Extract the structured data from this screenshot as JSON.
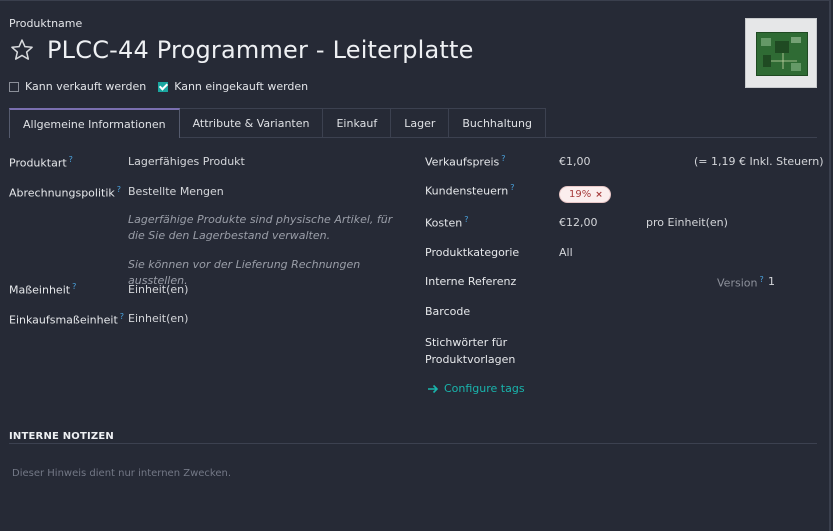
{
  "header": {
    "product_name_label": "Produktname",
    "title": "PLCC-44 Programmer - Leiterplatte",
    "can_be_sold_label": "Kann verkauft werden",
    "can_be_sold": false,
    "can_be_purchased_label": "Kann eingekauft werden",
    "can_be_purchased": true
  },
  "tabs": [
    {
      "label": "Allgemeine Informationen",
      "active": true
    },
    {
      "label": "Attribute & Varianten"
    },
    {
      "label": "Einkauf"
    },
    {
      "label": "Lager"
    },
    {
      "label": "Buchhaltung"
    }
  ],
  "left": {
    "product_type_label": "Produktart",
    "product_type_value": "Lagerfähiges Produkt",
    "invoice_policy_label": "Abrechnungspolitik",
    "invoice_policy_value": "Bestellte Mengen",
    "hint_1": "Lagerfähige Produkte sind physische Artikel, für die Sie den Lagerbestand verwalten.",
    "hint_2": "Sie können vor der Lieferung Rechnungen ausstellen.",
    "uom_label": "Maßeinheit",
    "uom_value": "Einheit(en)",
    "purchase_uom_label": "Einkaufsmaßeinheit",
    "purchase_uom_value": "Einheit(en)"
  },
  "right": {
    "sales_price_label": "Verkaufspreis",
    "sales_price_value": "€1,00",
    "sales_price_incl": "(= 1,19 € Inkl. Steuern)",
    "customer_taxes_label": "Kundensteuern",
    "tax_badge": "19%",
    "cost_label": "Kosten",
    "cost_value": "€12,00",
    "cost_unit": "pro Einheit(en)",
    "category_label": "Produktkategorie",
    "category_value": "All",
    "internal_ref_label": "Interne Referenz",
    "version_label": "Version",
    "version_value": "1",
    "barcode_label": "Barcode",
    "tags_label_line1": "Stichwörter für",
    "tags_label_line2": "Produktvorlagen",
    "configure_tags": "Configure tags"
  },
  "notes": {
    "title": "INTERNE NOTIZEN",
    "placeholder": "Dieser Hinweis dient nur internen Zwecken."
  },
  "colors": {
    "background": "#262a36",
    "accent": "#19b4ac",
    "help": "#4aa3df",
    "tab_active": "#7a6fb0",
    "badge_bg": "#fbeeee",
    "badge_text": "#a63b3b"
  }
}
